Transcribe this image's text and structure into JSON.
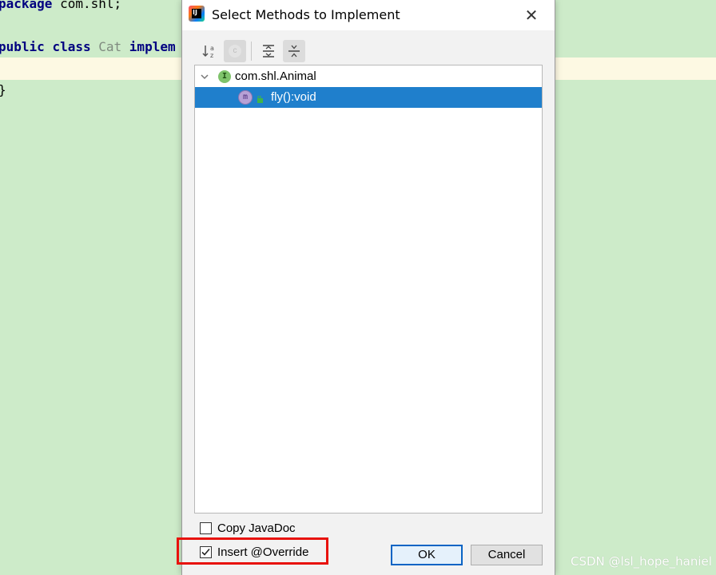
{
  "editor": {
    "line1": {
      "kw": "package",
      "rest": " com.shl;"
    },
    "line2": {
      "kw1": "public",
      "kw2": "class",
      "cls": "Cat",
      "kw3": "implem"
    },
    "line4": "}"
  },
  "dialog": {
    "title": "Select Methods to Implement",
    "close_glyph": "✕",
    "app_icon": "intellij-idea-icon",
    "toolbar": {
      "sort_icon": "sort-alphabetically-icon",
      "inherited_icon": "show-inherited-icon",
      "inherited_glyph": "c",
      "expand_icon": "expand-all-icon",
      "collapse_icon": "collapse-all-icon"
    },
    "tree": {
      "parent": {
        "icon_glyph": "I",
        "label": "com.shl.Animal"
      },
      "child": {
        "icon_glyph": "m",
        "label": "fly():void"
      }
    },
    "options": {
      "copy_javadoc": {
        "label": "Copy JavaDoc",
        "checked": false
      },
      "insert_override": {
        "label": "Insert @Override",
        "checked": true
      }
    },
    "buttons": {
      "ok": "OK",
      "cancel": "Cancel"
    }
  },
  "colors": {
    "editor_bg": "#cdebc9",
    "selection": "#1f7fcc",
    "highlight_border": "#e8120c"
  },
  "watermark": "CSDN @lsl_hope_haniel"
}
